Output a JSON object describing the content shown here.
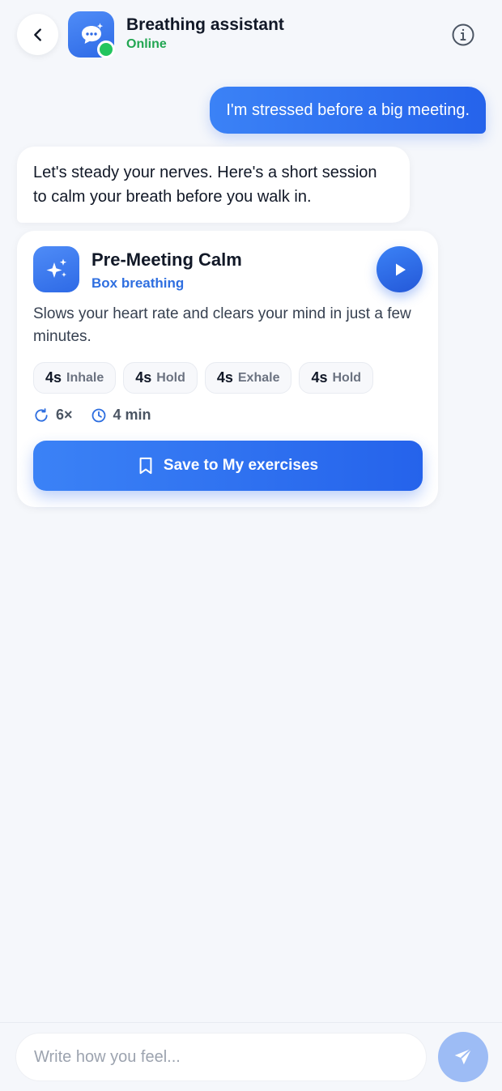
{
  "header": {
    "title": "Breathing assistant",
    "status": "Online",
    "status_color": "#22a652",
    "back_icon": "chevron-left-icon",
    "avatar_icon": "chat-sparkle-icon",
    "info_icon": "info-icon"
  },
  "messages": {
    "user_1": "I'm stressed before a big meeting.",
    "assistant_1": "Let's steady your nerves. Here's a short session to calm your breath before you walk in."
  },
  "exercise": {
    "icon": "sparkles-icon",
    "title": "Pre-Meeting Calm",
    "subtitle": "Box breathing",
    "description": "Slows your heart rate and clears your mind in just a few minutes.",
    "steps": [
      {
        "seconds": "4s",
        "label": "Inhale"
      },
      {
        "seconds": "4s",
        "label": "Hold"
      },
      {
        "seconds": "4s",
        "label": "Exhale"
      },
      {
        "seconds": "4s",
        "label": "Hold"
      }
    ],
    "repeats": "6×",
    "duration": "4 min",
    "save_label": "Save to My exercises"
  },
  "composer": {
    "placeholder": "Write how you feel..."
  },
  "colors": {
    "accent": "#2563eb",
    "background": "#f5f7fb",
    "send_disabled": "#9dbcf5"
  }
}
